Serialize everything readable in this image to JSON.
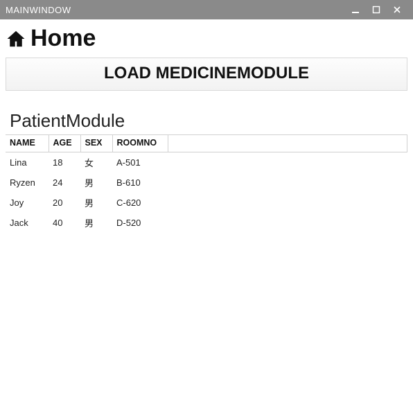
{
  "window": {
    "title": "MAINWINDOW"
  },
  "header": {
    "title": "Home"
  },
  "buttons": {
    "load_module": "LOAD MEDICINEMODULE"
  },
  "module": {
    "title": "PatientModule",
    "columns": {
      "name": "NAME",
      "age": "AGE",
      "sex": "SEX",
      "roomno": "ROOMNO"
    },
    "rows": [
      {
        "name": "Lina",
        "age": "18",
        "sex": "女",
        "roomno": "A-501"
      },
      {
        "name": "Ryzen",
        "age": "24",
        "sex": "男",
        "roomno": "B-610"
      },
      {
        "name": "Joy",
        "age": "20",
        "sex": "男",
        "roomno": "C-620"
      },
      {
        "name": "Jack",
        "age": "40",
        "sex": "男",
        "roomno": "D-520"
      }
    ]
  }
}
